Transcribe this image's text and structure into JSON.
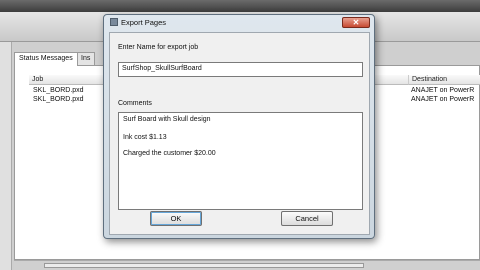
{
  "background": {
    "tabs": [
      {
        "label": "Status Messages"
      },
      {
        "label": "Ins"
      }
    ],
    "columns": {
      "job": "Job",
      "destination": "Destination"
    },
    "rows": [
      {
        "job": "SKL_BORD.pxd",
        "destination": "ANAJET on PowerR"
      },
      {
        "job": "SKL_BORD.pxd",
        "destination": "ANAJET on PowerR"
      }
    ]
  },
  "dialog": {
    "title": "Export Pages",
    "close_glyph": "✕",
    "name_label": "Enter Name for export job",
    "name_value": "SurfShop_SkullSurfBoard",
    "comments_label": "Comments",
    "comments_lines": [
      "Surf Board with Skull design",
      "Ink cost $1.13",
      "Charged the customer $20.00"
    ],
    "ok_label": "OK",
    "cancel_label": "Cancel"
  },
  "colors": {
    "dialog_frame": "#cbd6df",
    "close_button": "#c74a32",
    "default_button_focus": "#66a6d8"
  },
  "icons": {
    "dialog_icon": "window-icon",
    "close_icon": "close-icon"
  }
}
